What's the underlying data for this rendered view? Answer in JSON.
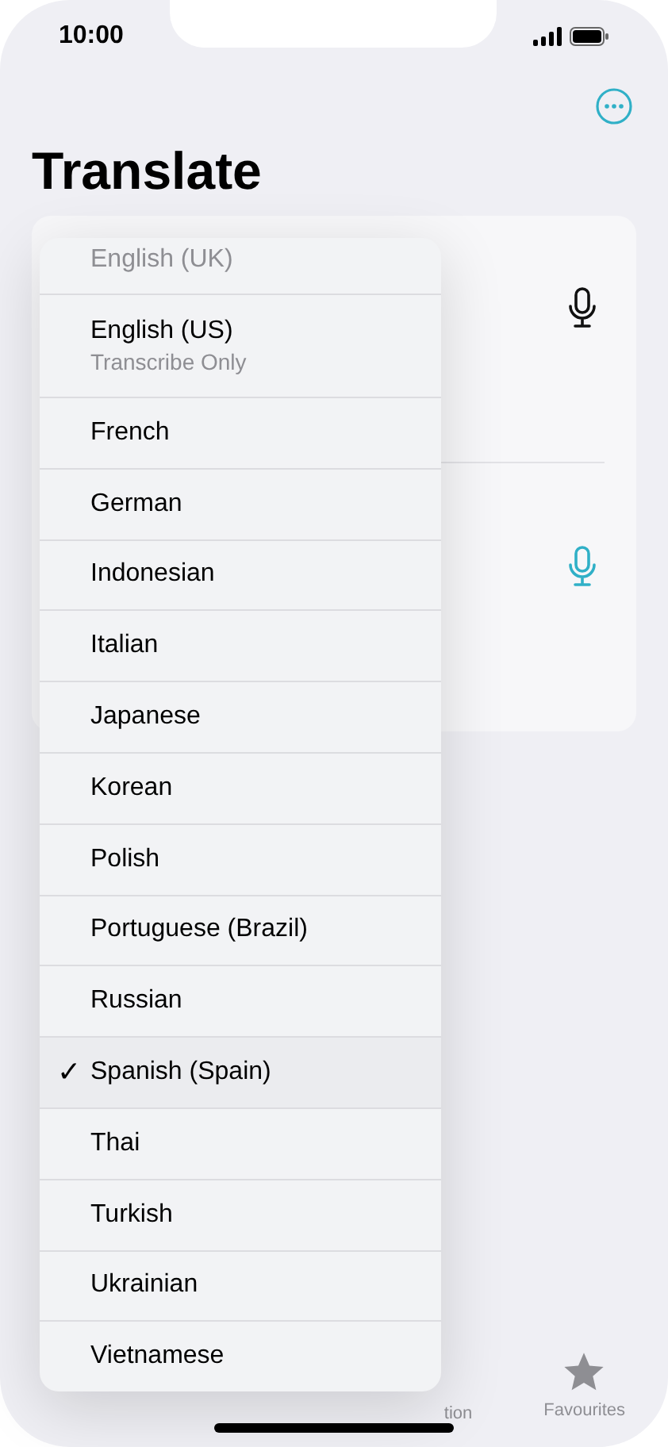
{
  "status_bar": {
    "time": "10:00"
  },
  "title": "Translate",
  "menu": {
    "check_mark": "✓",
    "items": [
      {
        "label": "English (UK)",
        "dimmed": true,
        "selected": false
      },
      {
        "label": "English (US)",
        "sublabel": "Transcribe Only",
        "dimmed": false,
        "selected": false
      },
      {
        "label": "French",
        "dimmed": false,
        "selected": false
      },
      {
        "label": "German",
        "dimmed": false,
        "selected": false
      },
      {
        "label": "Indonesian",
        "dimmed": false,
        "selected": false
      },
      {
        "label": "Italian",
        "dimmed": false,
        "selected": false
      },
      {
        "label": "Japanese",
        "dimmed": false,
        "selected": false
      },
      {
        "label": "Korean",
        "dimmed": false,
        "selected": false
      },
      {
        "label": "Polish",
        "dimmed": false,
        "selected": false
      },
      {
        "label": "Portuguese (Brazil)",
        "dimmed": false,
        "selected": false
      },
      {
        "label": "Russian",
        "dimmed": false,
        "selected": false
      },
      {
        "label": "Spanish (Spain)",
        "dimmed": false,
        "selected": true
      },
      {
        "label": "Thai",
        "dimmed": false,
        "selected": false
      },
      {
        "label": "Turkish",
        "dimmed": false,
        "selected": false
      },
      {
        "label": "Ukrainian",
        "dimmed": false,
        "selected": false
      },
      {
        "label": "Vietnamese",
        "dimmed": false,
        "selected": false
      }
    ]
  },
  "tab_bar": {
    "items": [
      {
        "label": "tion",
        "kind": "partial"
      },
      {
        "label": "Favourites",
        "kind": "star"
      }
    ]
  }
}
